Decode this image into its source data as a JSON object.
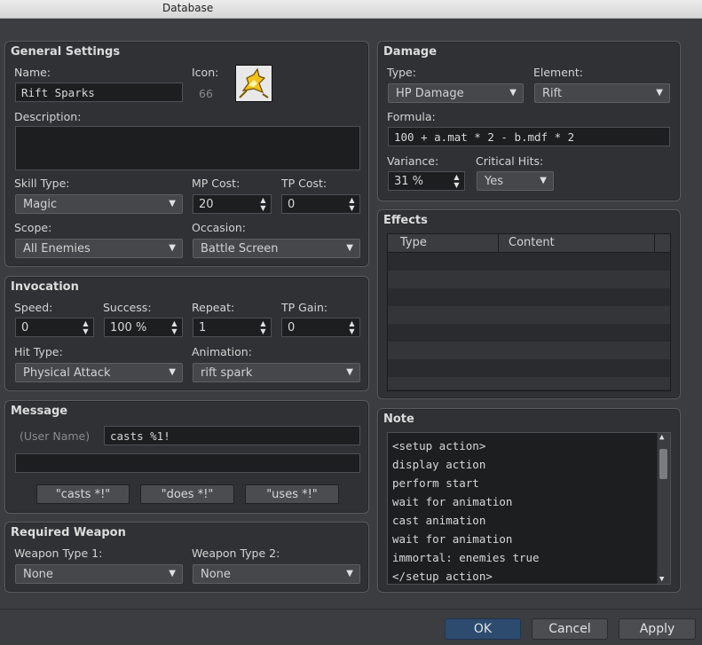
{
  "window": {
    "title": "Database"
  },
  "general": {
    "title": "General Settings",
    "name_label": "Name:",
    "name_value": "Rift Sparks",
    "icon_label": "Icon:",
    "icon_index": "66",
    "icon_name": "spark-skill-icon",
    "desc_label": "Description:",
    "desc_value": "",
    "skill_type_label": "Skill Type:",
    "skill_type_value": "Magic",
    "mp_label": "MP Cost:",
    "mp_value": "20",
    "tp_label": "TP Cost:",
    "tp_value": "0",
    "scope_label": "Scope:",
    "scope_value": "All Enemies",
    "occasion_label": "Occasion:",
    "occasion_value": "Battle Screen"
  },
  "invocation": {
    "title": "Invocation",
    "speed_label": "Speed:",
    "speed_value": "0",
    "success_label": "Success:",
    "success_value": "100 %",
    "repeat_label": "Repeat:",
    "repeat_value": "1",
    "tpgain_label": "TP Gain:",
    "tpgain_value": "0",
    "hittype_label": "Hit Type:",
    "hittype_value": "Physical Attack",
    "anim_label": "Animation:",
    "anim_value": "rift spark"
  },
  "message": {
    "title": "Message",
    "user_label": "(User Name)",
    "line1": "casts %1!",
    "line2": "",
    "btn_casts": "\"casts *!\"",
    "btn_does": "\"does *!\"",
    "btn_uses": "\"uses *!\""
  },
  "weapon": {
    "title": "Required Weapon",
    "type1_label": "Weapon Type 1:",
    "type1_value": "None",
    "type2_label": "Weapon Type 2:",
    "type2_value": "None"
  },
  "damage": {
    "title": "Damage",
    "type_label": "Type:",
    "type_value": "HP Damage",
    "element_label": "Element:",
    "element_value": "Rift",
    "formula_label": "Formula:",
    "formula_value": "100 + a.mat * 2 - b.mdf * 2",
    "variance_label": "Variance:",
    "variance_value": "31 %",
    "crit_label": "Critical Hits:",
    "crit_value": "Yes"
  },
  "effects": {
    "title": "Effects",
    "col_type": "Type",
    "col_content": "Content"
  },
  "note": {
    "title": "Note",
    "lines": [
      "<setup action>",
      "display action",
      "perform start",
      "wait for animation",
      "cast animation",
      "wait for animation",
      "immortal: enemies true",
      "</setup action>"
    ]
  },
  "buttons": {
    "ok": "OK",
    "cancel": "Cancel",
    "apply": "Apply"
  },
  "colors": {
    "accent_button": "#2d4b6e",
    "panel_bg": "#2f3134",
    "window_bg": "#3b3d40"
  }
}
